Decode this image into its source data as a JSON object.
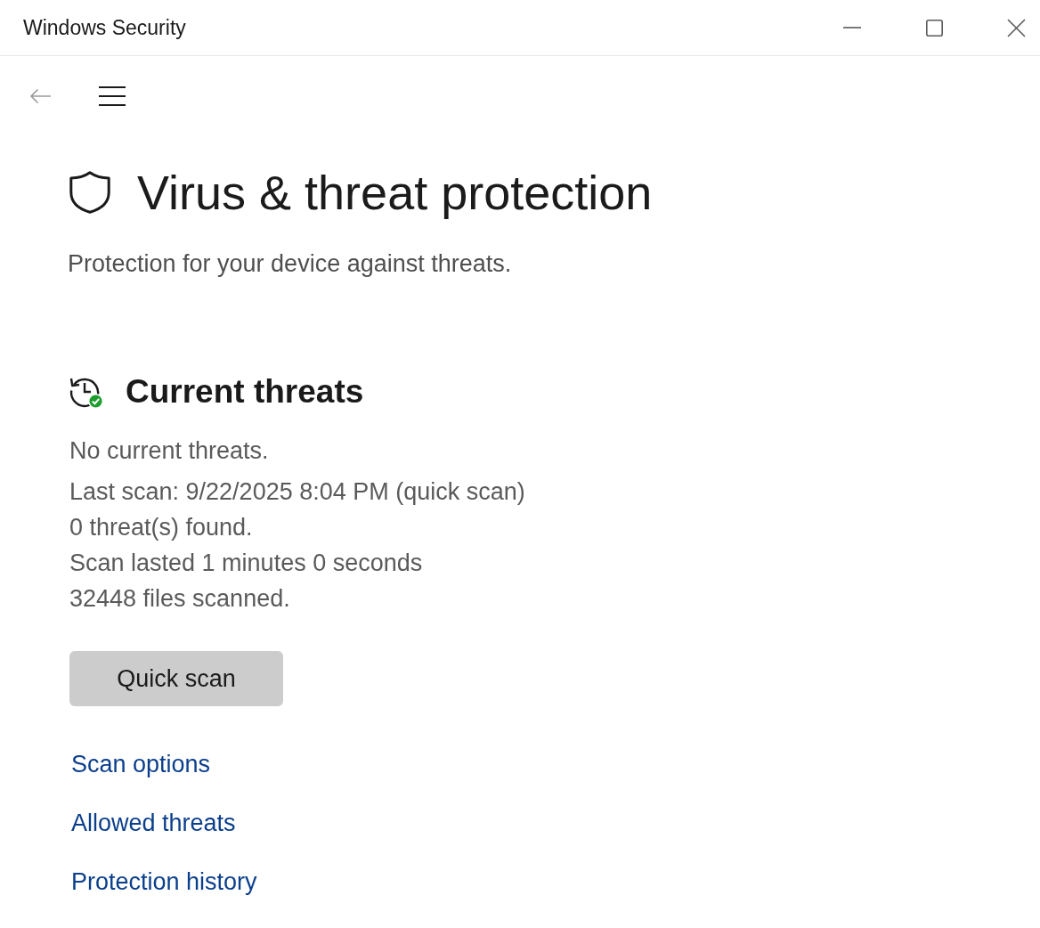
{
  "window": {
    "title": "Windows Security"
  },
  "nav": {
    "back": {
      "disabled": true
    }
  },
  "header": {
    "title": "Virus & threat protection",
    "subtitle": "Protection for your device against threats."
  },
  "current_threats": {
    "heading": "Current threats",
    "status": "No current threats.",
    "details": [
      "Last scan: 9/22/2025 8:04 PM (quick scan)",
      "0 threat(s) found.",
      "Scan lasted 1 minutes 0 seconds",
      "32448 files scanned."
    ],
    "action": {
      "label": "Quick scan"
    },
    "links": [
      {
        "label": "Scan options"
      },
      {
        "label": "Allowed threats"
      },
      {
        "label": "Protection history"
      }
    ]
  }
}
